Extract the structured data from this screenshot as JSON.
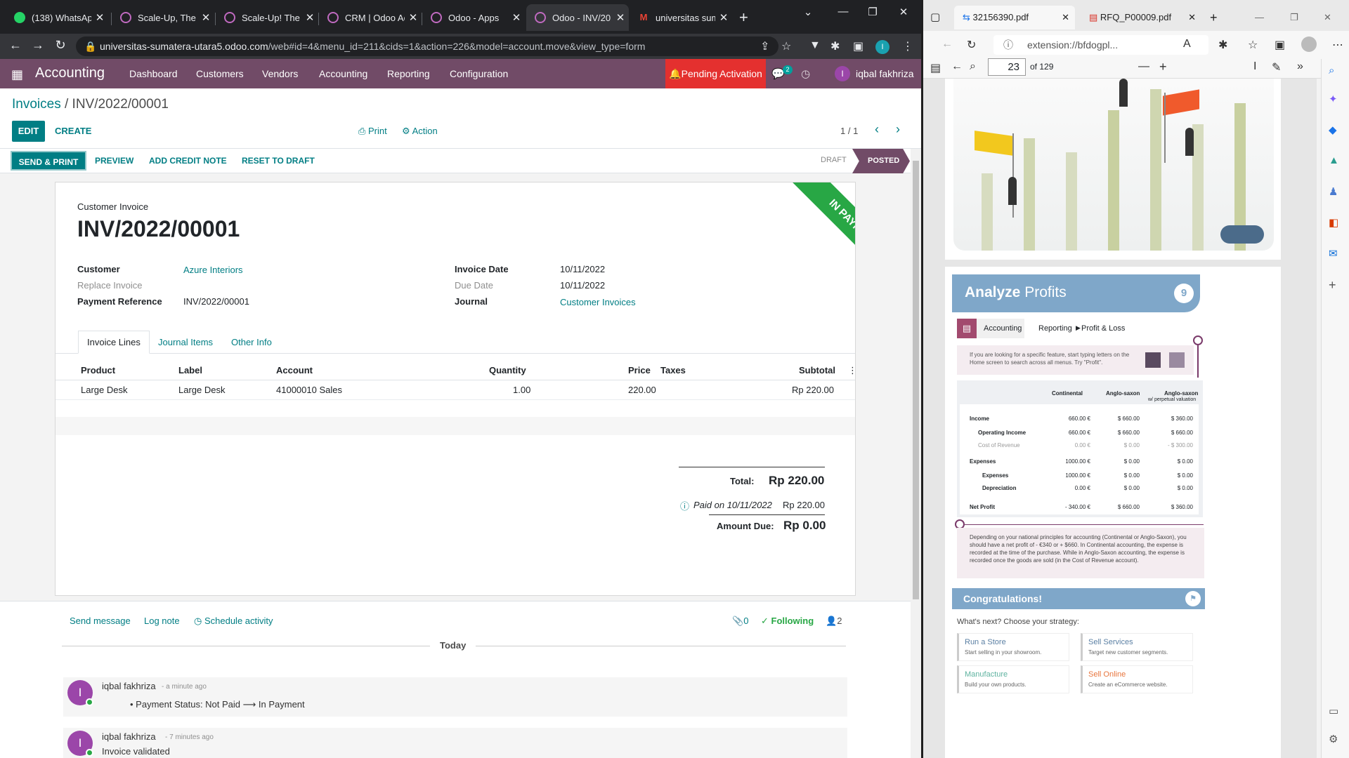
{
  "browser": {
    "tabs": [
      "(138) WhatsApp",
      "Scale-Up, The B",
      "Scale-Up! The B",
      "CRM | Odoo Ac",
      "Odoo - Apps",
      "Odoo - INV/20",
      "universitas sum"
    ],
    "url_host": "universitas-sumatera-utara5.odoo.com",
    "url_path": "/web#id=4&menu_id=211&cids=1&action=226&model=account.move&view_type=form",
    "avatar_letter": "I"
  },
  "odoo": {
    "app_name": "Accounting",
    "menus": [
      "Dashboard",
      "Customers",
      "Vendors",
      "Accounting",
      "Reporting",
      "Configuration"
    ],
    "pending_activation": "Pending Activation",
    "chat_count": "2",
    "user_name": "iqbal fakhriza",
    "user_initial": "I",
    "accent": "#714b67",
    "primary": "#017e84"
  },
  "control_panel": {
    "breadcrumb_parent": "Invoices",
    "breadcrumb_sep": " / ",
    "breadcrumb_current": "INV/2022/00001",
    "edit": "EDIT",
    "create": "CREATE",
    "print": "Print",
    "action": "Action",
    "pager": "1 / 1"
  },
  "statusbar": {
    "buttons": [
      "SEND & PRINT",
      "PREVIEW",
      "ADD CREDIT NOTE",
      "RESET TO DRAFT"
    ],
    "states": [
      "DRAFT",
      "POSTED"
    ],
    "active_state": "POSTED"
  },
  "invoice": {
    "type": "Customer Invoice",
    "number": "INV/2022/00001",
    "ribbon": "IN PAYMENT",
    "customer_label": "Customer",
    "customer": "Azure Interiors",
    "replace_label": "Replace Invoice",
    "payref_label": "Payment Reference",
    "payref": "INV/2022/00001",
    "date_label": "Invoice Date",
    "date": "10/11/2022",
    "due_label": "Due Date",
    "due": "10/11/2022",
    "journal_label": "Journal",
    "journal": "Customer Invoices",
    "tabs": [
      "Invoice Lines",
      "Journal Items",
      "Other Info"
    ],
    "columns": [
      "Product",
      "Label",
      "Account",
      "Quantity",
      "Price",
      "Taxes",
      "Subtotal"
    ],
    "lines": [
      {
        "product": "Large Desk",
        "label": "Large Desk",
        "account": "41000010 Sales",
        "quantity": "1.00",
        "price": "220.00",
        "taxes": "",
        "subtotal": "Rp 220.00"
      }
    ],
    "total_label": "Total:",
    "total": "Rp 220.00",
    "paid_label": "Paid on 10/11/2022",
    "paid_amount": "Rp 220.00",
    "due_amount_label": "Amount Due:",
    "amount_due": "Rp 0.00"
  },
  "chatter": {
    "send_message": "Send message",
    "log_note": "Log note",
    "schedule": "Schedule activity",
    "attachments": "0",
    "following": "Following",
    "followers": "2",
    "today": "Today",
    "messages": [
      {
        "author": "iqbal fakhriza",
        "time": "- a minute ago",
        "body": "Payment Status: Not Paid ⟶ In Payment"
      },
      {
        "author": "iqbal fakhriza",
        "time": "- 7 minutes ago",
        "body": "Invoice validated"
      }
    ]
  },
  "pdf_viewer": {
    "tabs": [
      "32156390.pdf",
      "RFQ_P00009.pdf"
    ],
    "url": "extension://bfdogpl...",
    "page": "23",
    "page_total": "of 129",
    "section_title_bold": "Analyze",
    "section_title_rest": " Profits",
    "section_number": "9",
    "crumb_app": "Accounting",
    "crumb_1": "Reporting",
    "crumb_2": "Profit & Loss",
    "tip": "If you are looking for a specific feature, start typing letters on the Home screen to search across all menus. Try \"Profit\".",
    "col_headers": [
      "Continental",
      "Anglo-saxon",
      "Anglo-saxon"
    ],
    "col_sub": "w/ perpetual valuation",
    "rows": [
      {
        "label": "Income",
        "v": [
          "660.00 €",
          "$ 660.00",
          "$ 360.00"
        ]
      },
      {
        "label": "Operating Income",
        "v": [
          "660.00 €",
          "$ 660.00",
          "$ 660.00"
        ]
      },
      {
        "label": "Cost of Revenue",
        "v": [
          "0.00 €",
          "$ 0.00",
          "- $ 300.00"
        ]
      },
      {
        "label": "Expenses",
        "v": [
          "1000.00 €",
          "$ 0.00",
          "$ 0.00"
        ]
      },
      {
        "label": "Expenses",
        "v": [
          "1000.00 €",
          "$ 0.00",
          "$ 0.00"
        ]
      },
      {
        "label": "Depreciation",
        "v": [
          "0.00 €",
          "$ 0.00",
          "$ 0.00"
        ]
      },
      {
        "label": "Net Profit",
        "v": [
          "- 340.00 €",
          "$ 660.00",
          "$ 360.00"
        ]
      }
    ],
    "note": "Depending on your national principles for accounting (Continental or Anglo-Saxon), you should have a net profit of - €340 or + $660. In Continental accounting, the expense is recorded at the time of the purchase. While in Anglo-Saxon accounting, the expense is recorded once the goods are sold (in the Cost of Revenue account).",
    "congrats": "Congratulations!",
    "next": "What's next? Choose your strategy:",
    "cards": [
      {
        "title": "Run a Store",
        "desc": "Start selling in your showroom.",
        "color": "#5a7fa3"
      },
      {
        "title": "Sell Services",
        "desc": "Target new customer segments.",
        "color": "#5a7fa3"
      },
      {
        "title": "Manufacture",
        "desc": "Build your own products.",
        "color": "#5fb3a0"
      },
      {
        "title": "Sell Online",
        "desc": "Create an eCommerce website.",
        "color": "#e8763e"
      }
    ]
  }
}
